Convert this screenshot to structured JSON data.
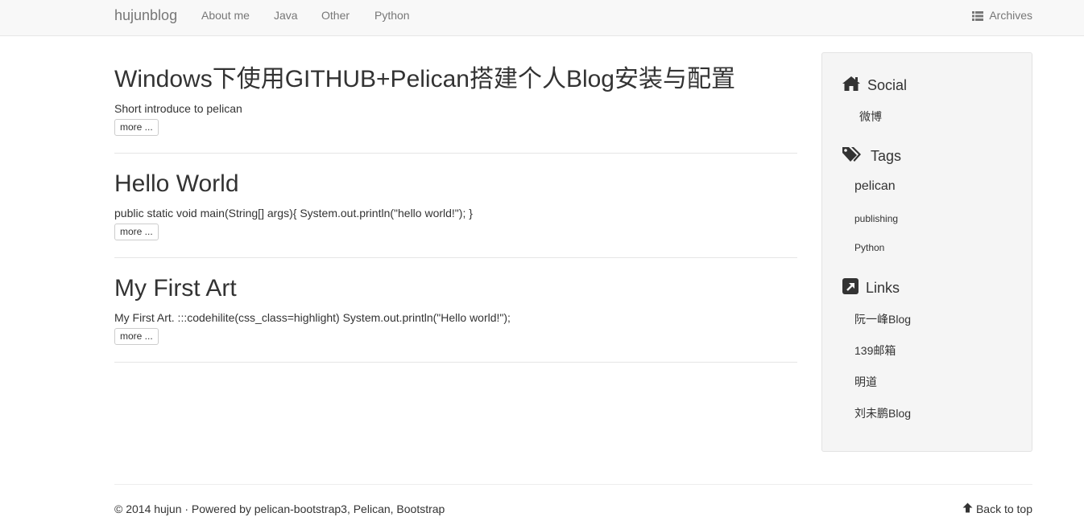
{
  "navbar": {
    "brand": "hujunblog",
    "items": [
      {
        "label": "About me"
      },
      {
        "label": "Java"
      },
      {
        "label": "Other"
      },
      {
        "label": "Python"
      }
    ],
    "archives_label": "Archives",
    "archives_icon": "list-icon"
  },
  "articles": [
    {
      "title": "Windows下使用GITHUB+Pelican搭建个人Blog安装与配置",
      "summary": "Short introduce to pelican",
      "more_label": "more ..."
    },
    {
      "title": "Hello World",
      "summary": "public static void main(String[] args){ System.out.println(\"hello world!\"); }",
      "more_label": "more ..."
    },
    {
      "title": "My First Art",
      "summary": "My First Art. :::codehilite(css_class=highlight) System.out.println(\"Hello world!\");",
      "more_label": "more ..."
    }
  ],
  "sidebar": {
    "social": {
      "heading": "Social",
      "icon": "home-icon",
      "items": [
        {
          "label": "微博"
        }
      ]
    },
    "tags": {
      "heading": "Tags",
      "icon": "tags-icon",
      "items": [
        {
          "label": "pelican"
        },
        {
          "label": "publishing"
        },
        {
          "label": "Python"
        }
      ]
    },
    "links": {
      "heading": "Links",
      "icon": "external-link-icon",
      "items": [
        {
          "label": "阮一峰Blog"
        },
        {
          "label": "139邮箱"
        },
        {
          "label": "明道"
        },
        {
          "label": "刘未鹏Blog"
        }
      ]
    }
  },
  "footer": {
    "copyright": "© 2014 hujun · Powered by pelican-bootstrap3, Pelican, Bootstrap",
    "back_to_top": "Back to top",
    "back_to_top_icon": "arrow-up-icon"
  },
  "colors": {
    "navbar_bg": "#f8f8f8",
    "nav_text": "#777777",
    "text": "#333333",
    "sidebar_bg": "#f5f5f5"
  }
}
